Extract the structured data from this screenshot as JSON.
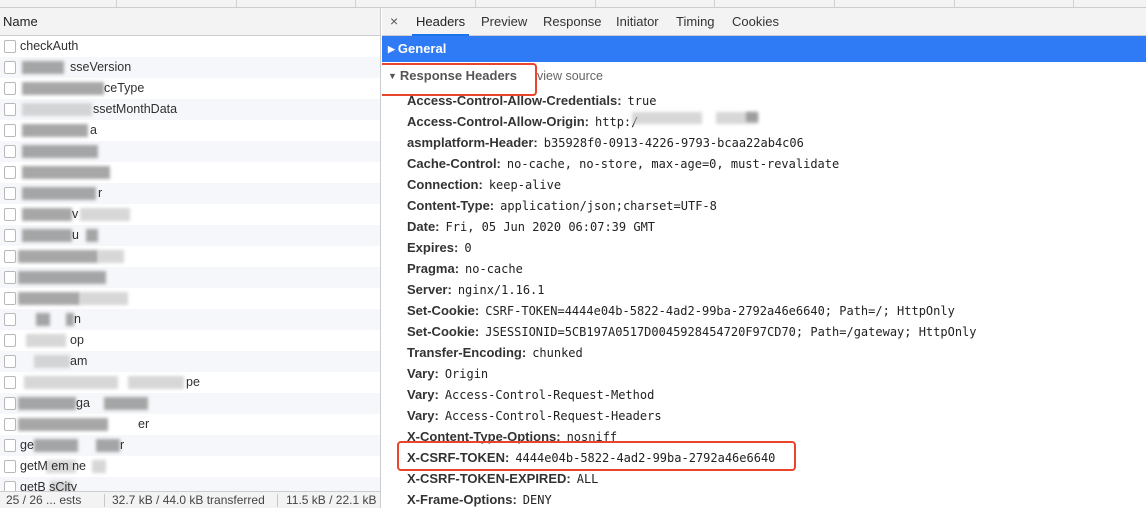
{
  "list": {
    "column_header": "Name",
    "requests": [
      {
        "name": "checkAuth"
      },
      {
        "name": "sseVersion"
      },
      {
        "name": "ceType"
      },
      {
        "name": "ssetMonthData"
      },
      {
        "name": "a"
      },
      {
        "name": ""
      },
      {
        "name": ""
      },
      {
        "name": "r"
      },
      {
        "name": "v"
      },
      {
        "name": "u"
      },
      {
        "name": ""
      },
      {
        "name": ""
      },
      {
        "name": ""
      },
      {
        "name": "n"
      },
      {
        "name": "op"
      },
      {
        "name": "am"
      },
      {
        "name": "pe"
      },
      {
        "name": "ga"
      },
      {
        "name": "er"
      },
      {
        "name": "r"
      },
      {
        "name": "getM    em   ne"
      },
      {
        "name": "getB    sCity"
      }
    ],
    "status": {
      "requests": "25 / 26 ... ests",
      "transferred": "32.7 kB / 44.0 kB transferred",
      "resources": "11.5 kB / 22.1 kB"
    }
  },
  "details": {
    "close_glyph": "×",
    "tabs": [
      "Headers",
      "Preview",
      "Response",
      "Initiator",
      "Timing",
      "Cookies"
    ],
    "active_tab": "Headers",
    "general": {
      "label": "General",
      "arrow": "▶"
    },
    "response_headers": {
      "label": "Response Headers",
      "arrow": "▼",
      "view_source": "view source",
      "items": [
        {
          "name": "Access-Control-Allow-Credentials:",
          "value": "true"
        },
        {
          "name": "Access-Control-Allow-Origin:",
          "value": "http:/"
        },
        {
          "name": "asmplatform-Header:",
          "value": "b35928f0-0913-4226-9793-bcaa22ab4c06"
        },
        {
          "name": "Cache-Control:",
          "value": "no-cache, no-store, max-age=0, must-revalidate"
        },
        {
          "name": "Connection:",
          "value": "keep-alive"
        },
        {
          "name": "Content-Type:",
          "value": "application/json;charset=UTF-8"
        },
        {
          "name": "Date:",
          "value": "Fri, 05 Jun 2020 06:07:39 GMT"
        },
        {
          "name": "Expires:",
          "value": "0"
        },
        {
          "name": "Pragma:",
          "value": "no-cache"
        },
        {
          "name": "Server:",
          "value": "nginx/1.16.1"
        },
        {
          "name": "Set-Cookie:",
          "value": "CSRF-TOKEN=4444e04b-5822-4ad2-99ba-2792a46e6640; Path=/; HttpOnly"
        },
        {
          "name": "Set-Cookie:",
          "value": "JSESSIONID=5CB197A0517D0045928454720F97CD70; Path=/gateway; HttpOnly"
        },
        {
          "name": "Transfer-Encoding:",
          "value": "chunked"
        },
        {
          "name": "Vary:",
          "value": "Origin"
        },
        {
          "name": "Vary:",
          "value": "Access-Control-Request-Method"
        },
        {
          "name": "Vary:",
          "value": "Access-Control-Request-Headers"
        },
        {
          "name": "X-Content-Type-Options:",
          "value": "nosniff"
        },
        {
          "name": "X-CSRF-TOKEN:",
          "value": "4444e04b-5822-4ad2-99ba-2792a46e6640"
        },
        {
          "name": "X-CSRF-TOKEN-EXPIRED:",
          "value": "ALL"
        },
        {
          "name": "X-Frame-Options:",
          "value": "DENY"
        }
      ]
    }
  },
  "colors": {
    "accent": "#1a73e8",
    "general_bar": "#2f7bf5",
    "highlight_box": "#e8452c"
  }
}
